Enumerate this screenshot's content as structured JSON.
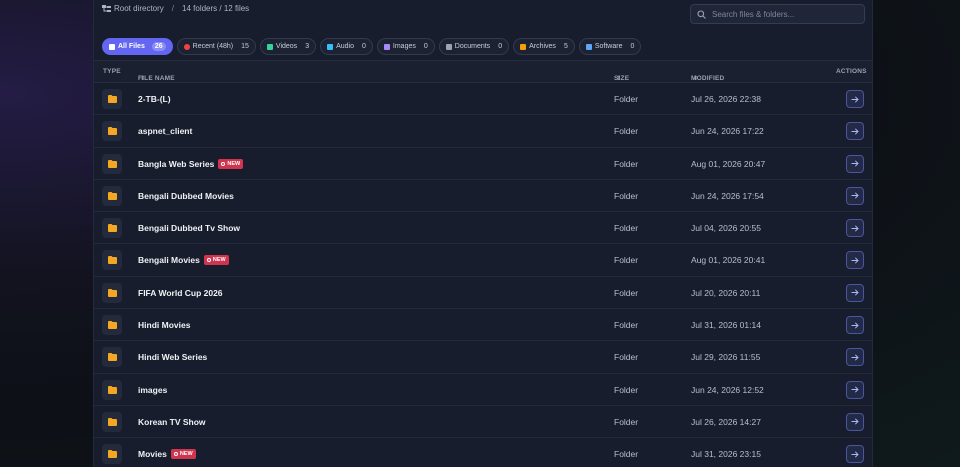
{
  "breadcrumb": {
    "root_label": "Root directory",
    "separator": "/",
    "summary": "14 folders / 12 files"
  },
  "search": {
    "placeholder": "Search files & folders..."
  },
  "filters": [
    {
      "label": "All Files",
      "count": "26",
      "icon": "grid-icon",
      "color": "#ffffff",
      "active": true
    },
    {
      "label": "Recent (48h)",
      "count": "15",
      "icon": "clock-icon",
      "color": "#ef4444"
    },
    {
      "label": "Videos",
      "count": "3",
      "icon": "film-icon",
      "color": "#34d399"
    },
    {
      "label": "Audio",
      "count": "0",
      "icon": "music-icon",
      "color": "#38bdf8"
    },
    {
      "label": "Images",
      "count": "0",
      "icon": "image-icon",
      "color": "#a78bfa"
    },
    {
      "label": "Documents",
      "count": "0",
      "icon": "document-icon",
      "color": "#9ca3af"
    },
    {
      "label": "Archives",
      "count": "5",
      "icon": "archive-icon",
      "color": "#f59e0b"
    },
    {
      "label": "Software",
      "count": "0",
      "icon": "software-icon",
      "color": "#60a5fa"
    }
  ],
  "table": {
    "headers": {
      "type": "TYPE",
      "name": "FILE NAME",
      "size": "SIZE",
      "modified": "MODIFIED",
      "actions": "ACTIONS"
    },
    "sort_glyph": "⇕",
    "new_label": "NEW",
    "rows": [
      {
        "name": "2-TB-(L)",
        "size": "Folder",
        "modified": "Jul 26, 2026 22:38",
        "is_new": false
      },
      {
        "name": "aspnet_client",
        "size": "Folder",
        "modified": "Jun 24, 2026 17:22",
        "is_new": false
      },
      {
        "name": "Bangla Web Series",
        "size": "Folder",
        "modified": "Aug 01, 2026 20:47",
        "is_new": true
      },
      {
        "name": "Bengali Dubbed Movies",
        "size": "Folder",
        "modified": "Jun 24, 2026 17:54",
        "is_new": false
      },
      {
        "name": "Bengali Dubbed Tv Show",
        "size": "Folder",
        "modified": "Jul 04, 2026 20:55",
        "is_new": false
      },
      {
        "name": "Bengali Movies",
        "size": "Folder",
        "modified": "Aug 01, 2026 20:41",
        "is_new": true
      },
      {
        "name": "FIFA World Cup 2026",
        "size": "Folder",
        "modified": "Jul 20, 2026 20:11",
        "is_new": false
      },
      {
        "name": "Hindi Movies",
        "size": "Folder",
        "modified": "Jul 31, 2026 01:14",
        "is_new": false
      },
      {
        "name": "Hindi Web Series",
        "size": "Folder",
        "modified": "Jul 29, 2026 11:55",
        "is_new": false
      },
      {
        "name": "images",
        "size": "Folder",
        "modified": "Jun 24, 2026 12:52",
        "is_new": false
      },
      {
        "name": "Korean TV Show",
        "size": "Folder",
        "modified": "Jul 26, 2026 14:27",
        "is_new": false
      },
      {
        "name": "Movies",
        "size": "Folder",
        "modified": "Jul 31, 2026 23:15",
        "is_new": true
      }
    ]
  },
  "colors": {
    "accent": "#6366f1",
    "folder": "#f5a623",
    "new_badge": "#d1344f"
  }
}
